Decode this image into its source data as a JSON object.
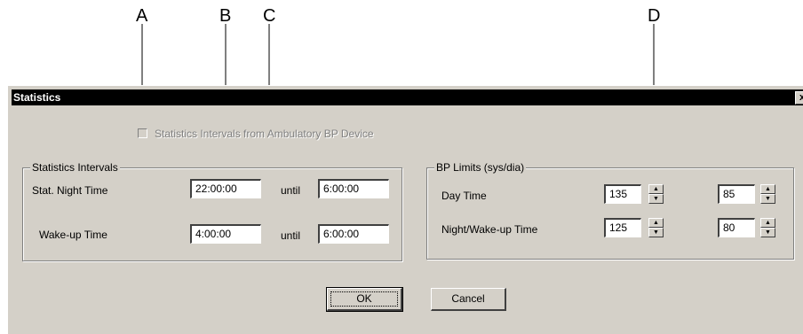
{
  "callouts": [
    {
      "letter": "A"
    },
    {
      "letter": "B"
    },
    {
      "letter": "C"
    },
    {
      "letter": "D"
    }
  ],
  "dialog": {
    "title": "Statistics",
    "close_glyph": "x",
    "checkbox_label": "Statistics Intervals from Ambulatory BP Device",
    "checkbox_checked": false,
    "checkbox_enabled": false,
    "intervals": {
      "legend": "Statistics Intervals",
      "night_label": "Stat. Night Time",
      "night_start": "22:00:00",
      "night_until_label": "until",
      "night_end": "6:00:00",
      "wake_label": "Wake-up Time",
      "wake_start": "4:00:00",
      "wake_until_label": "until",
      "wake_end": "6:00:00"
    },
    "bp_limits": {
      "legend": "BP Limits (sys/dia)",
      "day_label": "Day Time",
      "day_sys": "135",
      "day_dia": "85",
      "night_label": "Night/Wake-up Time",
      "night_sys": "125",
      "night_dia": "80"
    },
    "buttons": {
      "ok": "OK",
      "cancel": "Cancel"
    },
    "colors": {
      "face": "#d4d0c8",
      "titlebar": "#000000",
      "disabled_text": "#808080"
    }
  }
}
